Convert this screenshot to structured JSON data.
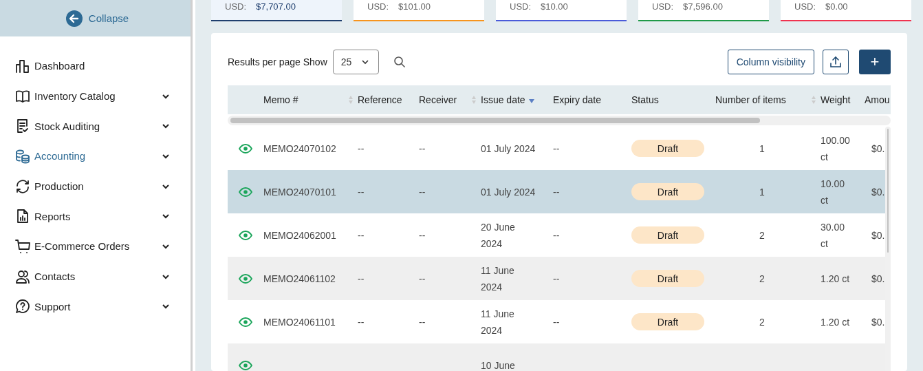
{
  "sidebar": {
    "collapse_label": "Collapse",
    "items": [
      {
        "label": "Dashboard",
        "kind": "chart",
        "selected": false,
        "expandable": false
      },
      {
        "label": "Inventory Catalog",
        "kind": "book",
        "selected": false,
        "expandable": true
      },
      {
        "label": "Stock Auditing",
        "kind": "audit",
        "selected": false,
        "expandable": true
      },
      {
        "label": "Accounting",
        "kind": "coins",
        "selected": true,
        "expandable": true
      },
      {
        "label": "Production",
        "kind": "refresh",
        "selected": false,
        "expandable": true
      },
      {
        "label": "Reports",
        "kind": "report",
        "selected": false,
        "expandable": true
      },
      {
        "label": "E-Commerce Orders",
        "kind": "cart",
        "selected": false,
        "expandable": true
      },
      {
        "label": "Contacts",
        "kind": "people",
        "selected": false,
        "expandable": true
      },
      {
        "label": "Support",
        "kind": "help",
        "selected": false,
        "expandable": true
      }
    ]
  },
  "summary_cards": [
    {
      "currency": "USD:",
      "amount": "$7,707.00",
      "color": "#1f3f6e",
      "selected": true
    },
    {
      "currency": "USD:",
      "amount": "$101.00",
      "color": "#f7941d",
      "selected": false
    },
    {
      "currency": "USD:",
      "amount": "$10.00",
      "color": "#4a5bd9",
      "selected": false
    },
    {
      "currency": "USD:",
      "amount": "$7,596.00",
      "color": "#1f9a48",
      "selected": false
    },
    {
      "currency": "USD:",
      "amount": "$0.00",
      "color": "#f0334f",
      "selected": false
    }
  ],
  "toolbar": {
    "results_label": "Results per page Show",
    "page_size": "25",
    "column_visibility": "Column visibility",
    "add_label": "+"
  },
  "table": {
    "columns": [
      {
        "label": "Memo #",
        "kind": "sortable"
      },
      {
        "label": "Reference",
        "kind": "plain"
      },
      {
        "label": "Receiver",
        "kind": "sortable"
      },
      {
        "label": "Issue date",
        "kind": "sorted-desc"
      },
      {
        "label": "Expiry date",
        "kind": "plain"
      },
      {
        "label": "Status",
        "kind": "plain"
      },
      {
        "label": "Number of items",
        "kind": "sortable"
      },
      {
        "label": "Weight",
        "kind": "plain"
      },
      {
        "label": "Amou",
        "kind": "plain"
      }
    ],
    "rows": [
      {
        "memo": "MEMO24070102",
        "reference": "--",
        "receiver": "--",
        "issue_date": "01 July 2024",
        "expiry_date": "--",
        "status": "Draft",
        "items": "1",
        "weight": "100.00 ct",
        "amount": "$0.",
        "selected": false
      },
      {
        "memo": "MEMO24070101",
        "reference": "--",
        "receiver": "--",
        "issue_date": "01 July 2024",
        "expiry_date": "--",
        "status": "Draft",
        "items": "1",
        "weight": "10.00 ct",
        "amount": "$0.",
        "selected": true
      },
      {
        "memo": "MEMO24062001",
        "reference": "--",
        "receiver": "--",
        "issue_date": "20 June 2024",
        "expiry_date": "--",
        "status": "Draft",
        "items": "2",
        "weight": "30.00 ct",
        "amount": "$0.",
        "selected": false
      },
      {
        "memo": "MEMO24061102",
        "reference": "--",
        "receiver": "--",
        "issue_date": "11 June 2024",
        "expiry_date": "--",
        "status": "Draft",
        "items": "2",
        "weight": "1.20 ct",
        "amount": "$0.",
        "selected": false
      },
      {
        "memo": "MEMO24061101",
        "reference": "--",
        "receiver": "--",
        "issue_date": "11 June 2024",
        "expiry_date": "--",
        "status": "Draft",
        "items": "2",
        "weight": "1.20 ct",
        "amount": "$0.",
        "selected": false
      },
      {
        "issue_date": "10 June",
        "selected": false
      }
    ]
  }
}
